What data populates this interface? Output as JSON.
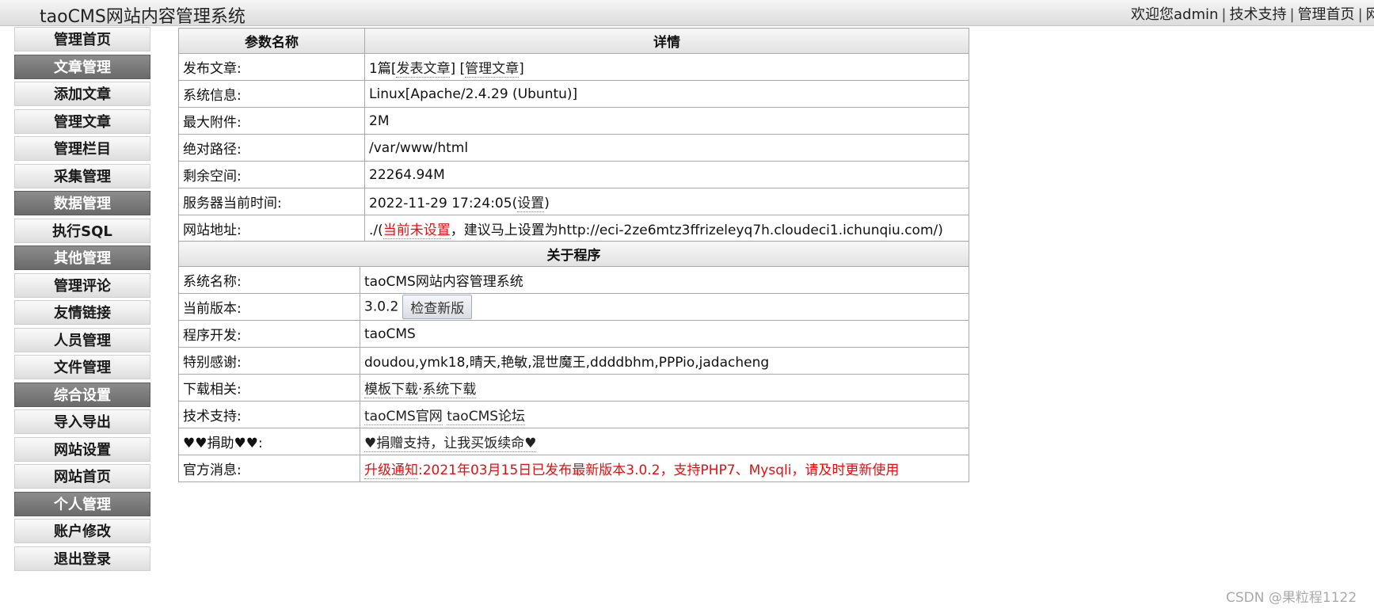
{
  "header": {
    "title": "taoCMS网站内容管理系统",
    "welcome": "欢迎您admin",
    "sep": "|",
    "links": [
      "技术支持",
      "管理首页",
      "网站首页"
    ]
  },
  "sidebar": {
    "items": [
      {
        "label": "管理首页",
        "type": "link"
      },
      {
        "label": "文章管理",
        "type": "category"
      },
      {
        "label": "添加文章",
        "type": "link"
      },
      {
        "label": "管理文章",
        "type": "link"
      },
      {
        "label": "管理栏目",
        "type": "link"
      },
      {
        "label": "采集管理",
        "type": "link"
      },
      {
        "label": "数据管理",
        "type": "category"
      },
      {
        "label": "执行SQL",
        "type": "link"
      },
      {
        "label": "其他管理",
        "type": "category"
      },
      {
        "label": "管理评论",
        "type": "link"
      },
      {
        "label": "友情链接",
        "type": "link"
      },
      {
        "label": "人员管理",
        "type": "link"
      },
      {
        "label": "文件管理",
        "type": "link"
      },
      {
        "label": "综合设置",
        "type": "category"
      },
      {
        "label": "导入导出",
        "type": "link"
      },
      {
        "label": "网站设置",
        "type": "link"
      },
      {
        "label": "网站首页",
        "type": "link"
      },
      {
        "label": "个人管理",
        "type": "category"
      },
      {
        "label": "账户修改",
        "type": "link"
      },
      {
        "label": "退出登录",
        "type": "link"
      }
    ]
  },
  "params": {
    "header_name": "参数名称",
    "header_detail": "详情",
    "articles": {
      "label": "发布文章:",
      "count": "1篇",
      "post_link": "发表文章",
      "manage_link": "管理文章"
    },
    "sysinfo": {
      "label": "系统信息:",
      "value": "Linux[Apache/2.4.29 (Ubuntu)]"
    },
    "maxattach": {
      "label": "最大附件:",
      "value": "2M"
    },
    "abspath": {
      "label": "绝对路径:",
      "value": "/var/www/html"
    },
    "space": {
      "label": "剩余空间:",
      "value": "22264.94M"
    },
    "time": {
      "label": "服务器当前时间:",
      "value": "2022-11-29 17:24:05",
      "link": "设置"
    },
    "site": {
      "label": "网站地址:",
      "prefix": "./(",
      "notset": "当前未设置",
      "suggest": "，建议马上设置为",
      "url": "http://eci-2ze6mtz3ffrizeleyq7h.cloudeci1.ichunqiu.com/",
      "suffix": ")"
    }
  },
  "about": {
    "header": "关于程序",
    "sysname": {
      "label": "系统名称:",
      "value": "taoCMS网站内容管理系统"
    },
    "version": {
      "label": "当前版本:",
      "value": "3.0.2",
      "button": "检查新版"
    },
    "developer": {
      "label": "程序开发:",
      "value": "taoCMS"
    },
    "thanks": {
      "label": "特别感谢:",
      "value": "doudou,ymk18,晴天,艳敏,混世魔王,ddddbhm,PPPio,jadacheng"
    },
    "download": {
      "label": "下载相关:",
      "link1": "模板下载",
      "sep": "·",
      "link2": "系统下载"
    },
    "support": {
      "label": "技术支持:",
      "link1": "taoCMS官网",
      "link2": "taoCMS论坛"
    },
    "donate": {
      "label": "♥♥捐助♥♥:",
      "link": "♥捐赠支持，让我买饭续命♥"
    },
    "news": {
      "label": "官方消息:",
      "prefix": "升级通知",
      "text": ":2021年03月15日已发布最新版本3.0.2，支持PHP7、Mysqli，请及时更新使用"
    }
  },
  "watermark": "CSDN @果粒程1122",
  "colors": {
    "alert_red": "#e31010",
    "category_bg": "#7a7a7a"
  }
}
